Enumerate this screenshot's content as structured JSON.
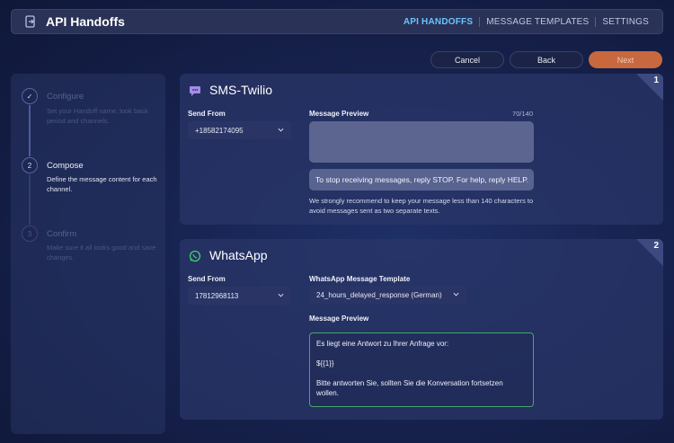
{
  "header": {
    "title": "API Handoffs",
    "nav": [
      "API HANDOFFS",
      "MESSAGE TEMPLATES",
      "SETTINGS"
    ]
  },
  "actions": {
    "cancel": "Cancel",
    "back": "Back",
    "next": "Next"
  },
  "steps": [
    {
      "title": "Configure",
      "desc": "Set your Handoff name, look back period and channels.",
      "marker": "✓"
    },
    {
      "title": "Compose",
      "desc": "Define the message content for each channel.",
      "marker": "2"
    },
    {
      "title": "Confirm",
      "desc": "Make sure it all looks good and save changes.",
      "marker": "3"
    }
  ],
  "sms": {
    "number": "1",
    "title": "SMS-Twilio",
    "send_from_label": "Send From",
    "send_from_value": "+18582174095",
    "preview_label": "Message Preview",
    "counter": "70/140",
    "preview_text": "To stop receiving messages, reply STOP. For help, reply HELP.",
    "hint": "We strongly recommend to keep your message less than 140 characters to avoid messages sent as two separate texts."
  },
  "whatsapp": {
    "number": "2",
    "title": "WhatsApp",
    "send_from_label": "Send From",
    "send_from_value": "17812968113",
    "template_label": "WhatsApp Message Template",
    "template_value": "24_hours_delayed_response (German)",
    "preview_label": "Message Preview",
    "preview_lines": [
      "Es liegt eine Antwort zu Ihrer Anfrage vor:",
      "${{1}}",
      "Bitte antworten Sie, sollten Sie die Konversation fortsetzen wollen."
    ]
  },
  "colors": {
    "accent": "#6cc2ff",
    "next_button": "#c8683e",
    "whatsapp_green": "#43a96a"
  }
}
